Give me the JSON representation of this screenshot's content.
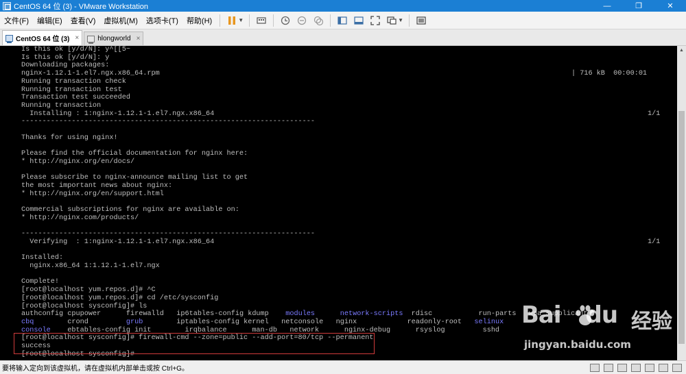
{
  "window": {
    "title": "CentOS 64 位 (3) - VMware Workstation",
    "minimize": "—",
    "restore": "❐",
    "close": "✕"
  },
  "menu": {
    "items": [
      "文件(F)",
      "编辑(E)",
      "查看(V)",
      "虚拟机(M)",
      "选项卡(T)",
      "帮助(H)"
    ]
  },
  "tabs": [
    {
      "label": "CentOS 64 位 (3)",
      "active": true,
      "close": "×"
    },
    {
      "label": "hlongworld",
      "active": false,
      "close": "×"
    }
  ],
  "console": {
    "lines": [
      "Is this ok [y/d/N]: y^[[5~",
      "Is this ok [y/d/N]: y",
      "Downloading packages:",
      "nginx-1.12.1-1.el7.ngx.x86_64.rpm",
      "Running transaction check",
      "Running transaction test",
      "Transaction test succeeded",
      "Running transaction",
      "  Installing : 1:nginx-1.12.1-1.el7.ngx.x86_64",
      "----------------------------------------------------------------------",
      "",
      "Thanks for using nginx!",
      "",
      "Please find the official documentation for nginx here:",
      "* http://nginx.org/en/docs/",
      "",
      "Please subscribe to nginx-announce mailing list to get",
      "the most important news about nginx:",
      "* http://nginx.org/en/support.html",
      "",
      "Commercial subscriptions for nginx are available on:",
      "* http://nginx.com/products/",
      "",
      "----------------------------------------------------------------------",
      "  Verifying  : 1:nginx-1.12.1-1.el7.ngx.x86_64",
      "",
      "Installed:",
      "  nginx.x86_64 1:1.12.1-1.el7.ngx",
      "",
      "Complete!",
      "[root@localhost yum.repos.d]# ^C",
      "[root@localhost yum.repos.d]# cd /etc/sysconfig",
      "[root@localhost sysconfig]# ls"
    ],
    "download_stats": "| 716 kB  00:00:01",
    "install_progress": "1/1",
    "verify_progress": "1/1",
    "ls_rows": [
      [
        {
          "t": "authconfig",
          "c": ""
        },
        {
          "t": "cpupower",
          "c": ""
        },
        {
          "t": "firewalld",
          "c": ""
        },
        {
          "t": "ip6tables-config",
          "c": ""
        },
        {
          "t": "kdump",
          "c": ""
        },
        {
          "t": "modules",
          "c": "c-blue"
        },
        {
          "t": "network-scripts",
          "c": "c-blue"
        },
        {
          "t": "rdisc",
          "c": ""
        },
        {
          "t": "run-parts",
          "c": ""
        },
        {
          "t": "wpa_supplicant",
          "c": ""
        }
      ],
      [
        {
          "t": "cbq",
          "c": "c-blue"
        },
        {
          "t": "crond",
          "c": ""
        },
        {
          "t": "grub",
          "c": "c-blue"
        },
        {
          "t": "iptables-config",
          "c": ""
        },
        {
          "t": "kernel",
          "c": ""
        },
        {
          "t": "netconsole",
          "c": ""
        },
        {
          "t": "nginx",
          "c": ""
        },
        {
          "t": "readonly-root",
          "c": ""
        },
        {
          "t": "selinux",
          "c": "c-blue"
        },
        {
          "t": "",
          "c": ""
        }
      ],
      [
        {
          "t": "console",
          "c": "c-blue"
        },
        {
          "t": "ebtables-config",
          "c": ""
        },
        {
          "t": "init",
          "c": ""
        },
        {
          "t": "irqbalance",
          "c": ""
        },
        {
          "t": "man-db",
          "c": ""
        },
        {
          "t": "network",
          "c": ""
        },
        {
          "t": "nginx-debug",
          "c": ""
        },
        {
          "t": "rsyslog",
          "c": ""
        },
        {
          "t": "sshd",
          "c": ""
        },
        {
          "t": "",
          "c": ""
        }
      ]
    ],
    "cmd_line": "[root@localhost sysconfig]# firewall-cmd --zone=public --add-port=80/tcp --permanent",
    "cmd_result": "success",
    "prompt_line": "[root@localhost sysconfig]#"
  },
  "statusbar": {
    "hint": "要将输入定向到该虚拟机，请在虚拟机内部单击或按 Ctrl+G。"
  },
  "watermark": {
    "logo_part1": "Bai",
    "logo_part2": "du",
    "logo_text": "经验",
    "sub": "jingyan.baidu.com"
  }
}
